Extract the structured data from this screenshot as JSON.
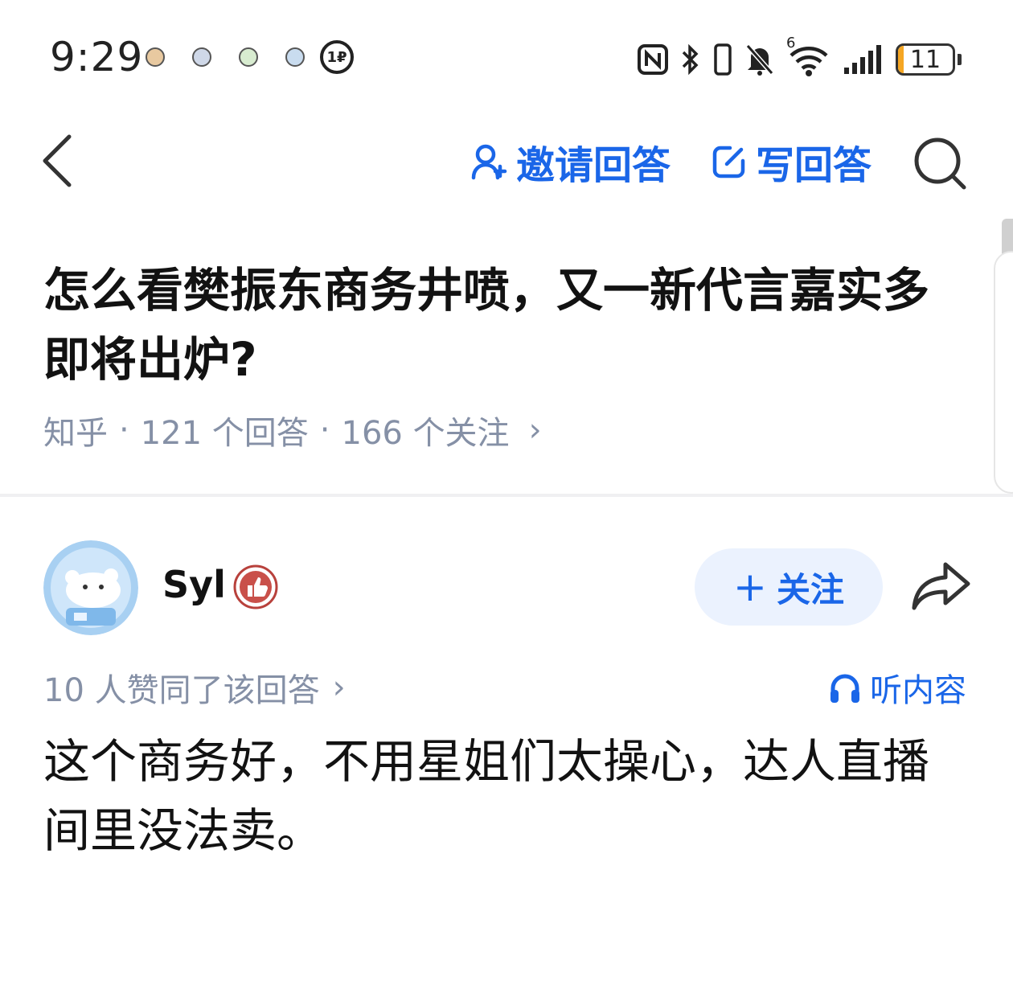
{
  "status_bar": {
    "time": "9:29",
    "battery": "11",
    "battery_level_percent": 11,
    "icons": [
      "nfc-icon",
      "bluetooth-icon",
      "vibrate-icon",
      "mute-icon",
      "wifi-icon",
      "signal-icon"
    ],
    "network_badge": "6"
  },
  "nav": {
    "invite_label": "邀请回答",
    "write_label": "写回答"
  },
  "question": {
    "title": "怎么看樊振东商务井喷，又一新代言嘉实多即将出炉?",
    "source": "知乎",
    "answers": "121 个回答",
    "followers": "166 个关注",
    "separator": "·",
    "chevron": "›"
  },
  "answer": {
    "author_name": "Syl",
    "follow_label": "关注",
    "follow_plus": "+",
    "agree_text": "10 人赞同了该回答",
    "agree_chevron": "›",
    "listen_label": "听内容",
    "content": "这个商务好，不用星姐们太操心，达人直播间里没法卖。"
  },
  "colors": {
    "accent": "#1a66e8",
    "meta_gray": "#8590a6",
    "follow_bg": "#ebf2fe",
    "battery_fill": "#f5a623"
  }
}
